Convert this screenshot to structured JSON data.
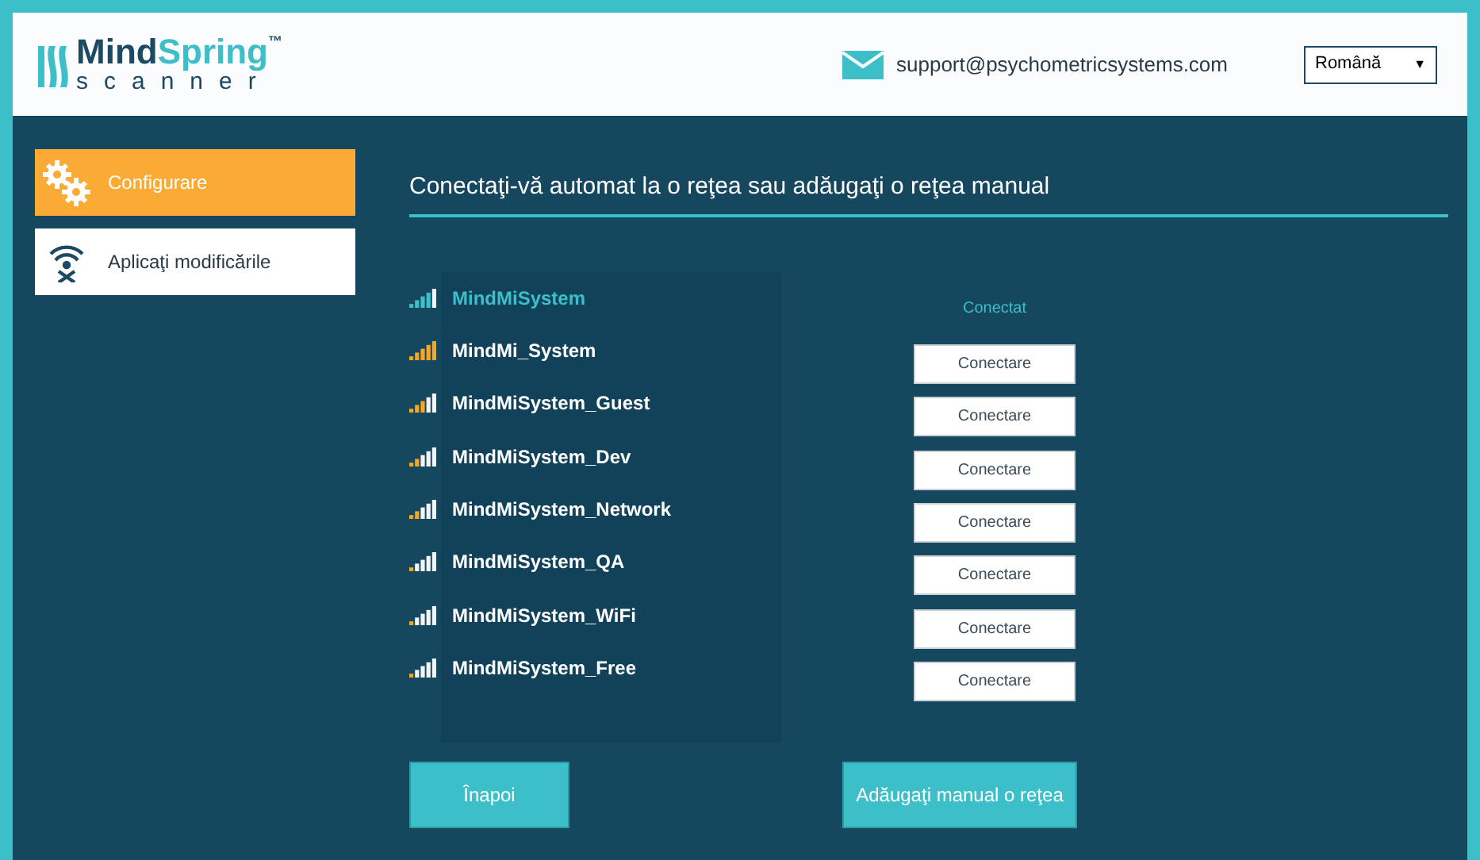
{
  "header": {
    "logo": {
      "name_dark": "Mind",
      "name_light": "Spring",
      "trademark": "™",
      "subtitle": "scanner"
    },
    "email": "support@psychometricsystems.com",
    "language": "Română",
    "language_caret": "▼"
  },
  "sidebar": {
    "items": [
      {
        "label": "Configurare",
        "selected": true
      },
      {
        "label": "Aplicaţi modificările",
        "selected": false
      }
    ]
  },
  "title": "Conectaţi-vă automat la o reţea sau adăugaţi o reţea manual",
  "networks": [
    {
      "name": "MindMiSystem",
      "connected": true,
      "level": 0.8,
      "status": "Conectat"
    },
    {
      "name": "MindMi_System",
      "connected": false,
      "level": 1,
      "action": "Conectare"
    },
    {
      "name": "MindMiSystem_Guest",
      "connected": false,
      "level": 0.6,
      "action": "Conectare"
    },
    {
      "name": "MindMiSystem_Dev",
      "connected": false,
      "level": 0.4,
      "action": "Conectare"
    },
    {
      "name": "MindMiSystem_Network",
      "connected": false,
      "level": 0.4,
      "action": "Conectare"
    },
    {
      "name": "MindMiSystem_QA",
      "connected": false,
      "level": 0.2,
      "action": "Conectare"
    },
    {
      "name": "MindMiSystem_WiFi",
      "connected": false,
      "level": 0.2,
      "action": "Conectare"
    },
    {
      "name": "MindMiSystem_Free",
      "connected": false,
      "level": 0.2,
      "action": "Conectare"
    }
  ],
  "buttons": [
    "Înapoi",
    "Adăugaţi manual o reţea"
  ]
}
